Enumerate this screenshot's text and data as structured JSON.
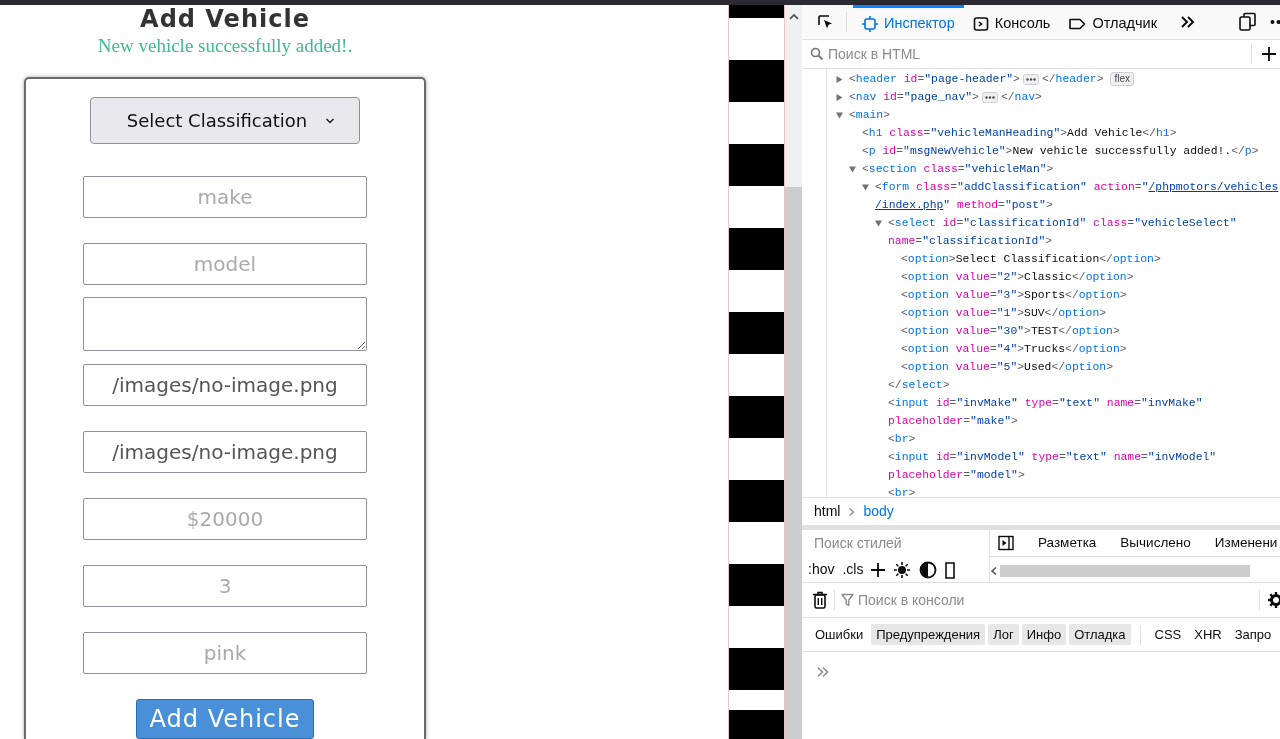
{
  "page": {
    "heading": "Add Vehicle",
    "message": "New vehicle successfully added!.",
    "classification_select": {
      "label": "Select Classification"
    },
    "fields": [
      {
        "kind": "input",
        "placeholder": "make"
      },
      {
        "kind": "input",
        "placeholder": "model"
      },
      {
        "kind": "textarea"
      },
      {
        "kind": "input",
        "value": "/images/no-image.png"
      },
      {
        "kind": "input",
        "value": "/images/no-image.png"
      },
      {
        "kind": "input",
        "placeholder": "$20000"
      },
      {
        "kind": "input",
        "placeholder": "3"
      },
      {
        "kind": "input",
        "placeholder": "pink"
      }
    ],
    "submit_button": "Add Vehicle"
  },
  "devtools": {
    "tabs": [
      {
        "label": "Инспектор",
        "selected": true
      },
      {
        "label": "Консоль",
        "selected": false
      },
      {
        "label": "Отладчик",
        "selected": false
      }
    ],
    "html_search": {
      "placeholder": "Поиск в HTML"
    },
    "dom_tree": [
      {
        "rows": [
          "<header id=\"page-header\">"
        ],
        "close": "</header>",
        "expanded": false,
        "badge": "flex"
      },
      {
        "rows": [
          "<nav id=\"page_nav\">"
        ],
        "close": "</nav>",
        "expanded": false
      },
      {
        "rows": [
          "<main>"
        ],
        "expanded": true,
        "children": [
          {
            "rows": [
              "<h1 class=\"vehicleManHeading\">Add Vehicle</h1>"
            ]
          },
          {
            "rows": [
              "<p id=\"msgNewVehicle\">New vehicle successfully added!.</p>"
            ]
          },
          {
            "rows": [
              "<section class=\"vehicleMan\">"
            ],
            "expanded": true,
            "children": [
              {
                "rows": [
                  {
                    "before": "<form class=\"addClassification\" action=\"",
                    "link": "/phpmotors/vehicles"
                  },
                  {
                    "link": "/index.php",
                    "after": "\" method=\"post\">"
                  }
                ],
                "expanded": true,
                "children": [
                  {
                    "rows": [
                      "<select id=\"classificationId\" class=\"vehicleSelect\"",
                      "name=\"classificationId\">"
                    ],
                    "expanded": true,
                    "close": "</select>",
                    "children": [
                      {
                        "rows": [
                          "<option>Select Classification</option>"
                        ]
                      },
                      {
                        "rows": [
                          "<option value=\"2\">Classic</option>"
                        ]
                      },
                      {
                        "rows": [
                          "<option value=\"3\">Sports</option>"
                        ]
                      },
                      {
                        "rows": [
                          "<option value=\"1\">SUV</option>"
                        ]
                      },
                      {
                        "rows": [
                          "<option value=\"30\">TEST</option>"
                        ]
                      },
                      {
                        "rows": [
                          "<option value=\"4\">Trucks</option>"
                        ]
                      },
                      {
                        "rows": [
                          "<option value=\"5\">Used</option>"
                        ]
                      }
                    ]
                  },
                  {
                    "rows": [
                      "<input id=\"invMake\" type=\"text\" name=\"invMake\"",
                      "placeholder=\"make\">"
                    ]
                  },
                  {
                    "rows": [
                      "<br>"
                    ]
                  },
                  {
                    "rows": [
                      "<input id=\"invModel\" type=\"text\" name=\"invModel\"",
                      "placeholder=\"model\">"
                    ]
                  },
                  {
                    "rows": [
                      "<br>"
                    ]
                  }
                ]
              }
            ]
          }
        ]
      }
    ],
    "breadcrumb": [
      {
        "label": "html",
        "selected": false
      },
      {
        "label": "body",
        "selected": true
      }
    ],
    "styles_filter": {
      "placeholder": "Поиск стилей"
    },
    "style_toggles": [
      ":hov",
      ".cls"
    ],
    "side_tabs": [
      "Разметка",
      "Вычислено",
      "Изменени"
    ],
    "console_filter": {
      "placeholder": "Поиск в консоли"
    },
    "console_levels": [
      {
        "label": "Ошибки",
        "selected": false
      },
      {
        "label": "Предупреждения",
        "selected": true
      },
      {
        "label": "Лог",
        "selected": true
      },
      {
        "label": "Инфо",
        "selected": true
      },
      {
        "label": "Отладка",
        "selected": true
      }
    ],
    "console_categories": [
      "CSS",
      "XHR",
      "Запро"
    ]
  }
}
